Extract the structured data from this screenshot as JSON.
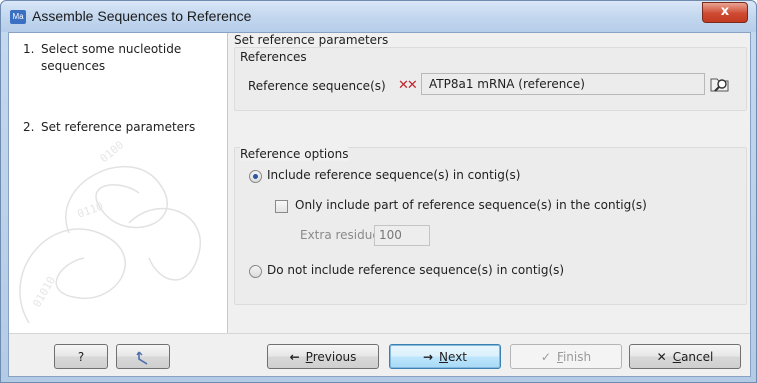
{
  "window": {
    "app_icon": "Ma",
    "title": "Assemble Sequences to Reference",
    "close_label": "x"
  },
  "steps": [
    {
      "num": "1.",
      "label": "Select some nucleotide sequences"
    },
    {
      "num": "2.",
      "label": "Set reference parameters"
    }
  ],
  "pane": {
    "heading": "Set reference parameters",
    "references": {
      "title": "References",
      "label": "Reference sequence(s)",
      "value": "ATP8a1 mRNA (reference)",
      "sequence_icon": "sequence-list-icon",
      "browse_icon": "folder-magnifier-icon"
    },
    "options": {
      "title": "Reference options",
      "include_label": "Include reference sequence(s) in contig(s)",
      "include_selected": true,
      "only_part_label": "Only include part of reference sequence(s) in the contig(s)",
      "only_part_checked": false,
      "extra_label": "Extra residues",
      "extra_value": "100",
      "exclude_label": "Do not include reference sequence(s) in contig(s)",
      "exclude_selected": false
    }
  },
  "buttons": {
    "help": "?",
    "reset_icon": "reset-arrow-icon",
    "previous_accel": "P",
    "previous_rest": "revious",
    "next_accel": "N",
    "next_rest": "ext",
    "finish_accel": "F",
    "finish_rest": "inish",
    "cancel_accel": "C",
    "cancel_rest": "ancel"
  }
}
